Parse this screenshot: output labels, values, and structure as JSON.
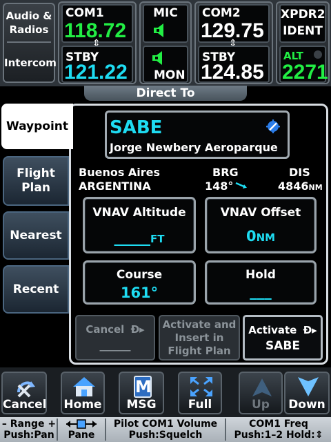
{
  "top": {
    "audio_label_1": "Audio &",
    "audio_label_2": "Radios",
    "intercom_label": "Intercom",
    "com1": {
      "label": "COM1",
      "active_freq": "118.72",
      "stby_label": "STBY",
      "stby_freq": "121.22"
    },
    "mic": {
      "label": "MIC",
      "mon_label": "MON"
    },
    "com2": {
      "label": "COM2",
      "active_freq": "129.75",
      "stby_label": "STBY",
      "stby_freq": "124.85"
    },
    "xpdr": {
      "label": "XPDR2",
      "mode": "IDENT",
      "alt_label": "ALT",
      "code": "2271"
    }
  },
  "page_title": "Direct To",
  "tabs": [
    {
      "label": "Waypoint",
      "active": true
    },
    {
      "label": "Flight Plan",
      "line1": "Flight",
      "line2": "Plan"
    },
    {
      "label": "Nearest"
    },
    {
      "label": "Recent"
    }
  ],
  "waypoint": {
    "ident": "SABE",
    "name": "Jorge Newbery Aeroparque",
    "city": "Buenos Aires",
    "country": "ARGENTINA",
    "brg_label": "BRG",
    "brg_value": "148°",
    "dis_label": "DIS",
    "dis_value": "4846",
    "dis_unit": "NM"
  },
  "vnav_altitude": {
    "label": "VNAV Altitude",
    "value": "_____",
    "unit": "FT"
  },
  "vnav_offset": {
    "label": "VNAV Offset",
    "value": "0",
    "unit": "NM"
  },
  "course": {
    "label": "Course",
    "value": "161°"
  },
  "hold": {
    "label": "Hold",
    "value": "___"
  },
  "actions": {
    "cancel_label": "Cancel",
    "cancel_value": "______",
    "insert_line1": "Activate and",
    "insert_line2": "Insert in",
    "insert_line3": "Flight Plan",
    "activate_label": "Activate",
    "activate_value": "SABE"
  },
  "softkeys": {
    "cancel": "Cancel",
    "home": "Home",
    "msg": "MSG",
    "full": "Full",
    "up": "Up",
    "down": "Down"
  },
  "help": {
    "range_1": "– Range +",
    "range_2": "Push:Pan",
    "pane_2": "Pane",
    "volume_1": "Pilot COM1 Volume",
    "volume_2": "Push:Squelch",
    "freq_1": "COM1 Freq",
    "freq_2": "Push:1–2 Hold:⇕"
  },
  "colors": {
    "cyan": "#1edcf2",
    "green": "#22ee44",
    "frame": "#d8dde2"
  }
}
